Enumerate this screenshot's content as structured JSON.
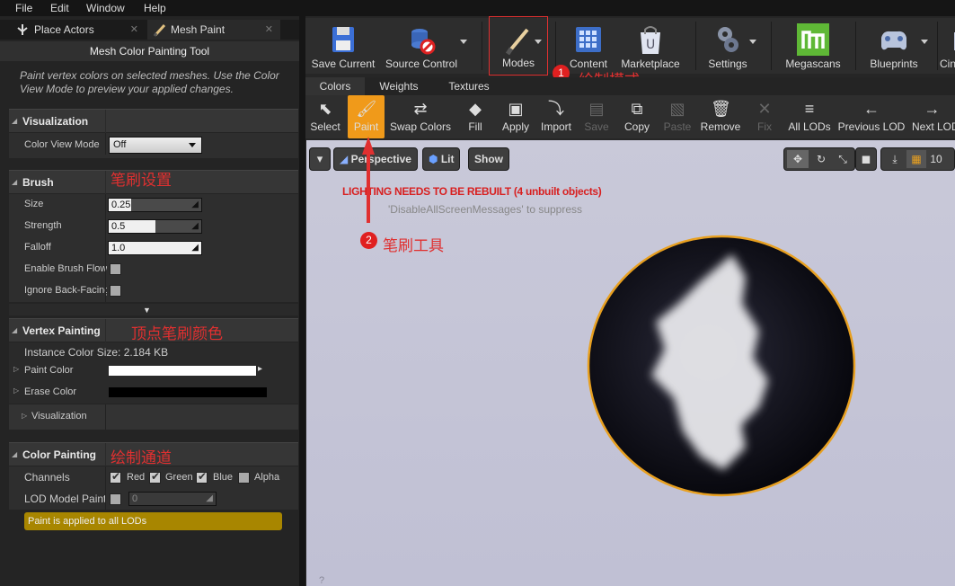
{
  "menu": {
    "file": "File",
    "edit": "Edit",
    "window": "Window",
    "help": "Help"
  },
  "left_tabs": {
    "place_actors": "Place Actors",
    "mesh_paint": "Mesh Paint",
    "close": "✕"
  },
  "tool_title": "Mesh Color Painting Tool",
  "description": "Paint vertex colors on selected meshes.  Use the Color View Mode to preview your applied changes.",
  "visualization": {
    "header": "Visualization",
    "color_view_mode_label": "Color View Mode",
    "color_view_mode_value": "Off"
  },
  "brush": {
    "header": "Brush",
    "size_label": "Size",
    "size_value": "0.25",
    "strength_label": "Strength",
    "strength_value": "0.5",
    "falloff_label": "Falloff",
    "falloff_value": "1.0",
    "enable_flow_label": "Enable Brush Flow",
    "ignore_backface_label": "Ignore Back-Facing"
  },
  "vertex_painting": {
    "header": "Vertex Painting",
    "instance_size": "Instance Color Size: 2.184 KB",
    "paint_color_label": "Paint Color",
    "erase_color_label": "Erase Color",
    "visualization_label": "Visualization",
    "paint_color": "#ffffff",
    "erase_color": "#000000"
  },
  "color_painting": {
    "header": "Color Painting",
    "channels_label": "Channels",
    "red": "Red",
    "green": "Green",
    "blue": "Blue",
    "alpha": "Alpha",
    "lod_label": "LOD Model Painting",
    "lod_value": "0",
    "notice": "Paint is applied to all LODs"
  },
  "annotations": {
    "brush_settings": "笔刷设置",
    "vertex_color": "顶点笔刷颜色",
    "paint_channel": "绘制通道",
    "paint_mode": "绘制模式",
    "brush_tool": "笔刷工具",
    "num1": "1",
    "num2": "2"
  },
  "toolbar": {
    "save_current": "Save Current",
    "source_control": "Source Control",
    "modes": "Modes",
    "content": "Content",
    "marketplace": "Marketplace",
    "settings": "Settings",
    "megascans": "Megascans",
    "blueprints": "Blueprints",
    "cinematics": "Cin"
  },
  "subtabs": {
    "colors": "Colors",
    "weights": "Weights",
    "textures": "Textures"
  },
  "paint_tools": {
    "select": "Select",
    "paint": "Paint",
    "swap": "Swap Colors",
    "fill": "Fill",
    "apply": "Apply",
    "import": "Import",
    "save": "Save",
    "copy": "Copy",
    "paste": "Paste",
    "remove": "Remove",
    "fix": "Fix",
    "all_lods": "All LODs",
    "prev_lod": "Previous LOD",
    "next_lod": "Next LOD"
  },
  "viewport": {
    "perspective": "Perspective",
    "lit": "Lit",
    "show": "Show",
    "warning": "LIGHTING NEEDS TO BE REBUILT (4 unbuilt objects)",
    "suppress": "'DisableAllScreenMessages' to suppress",
    "grid_size": "10"
  },
  "colors": {
    "accent": "#f0a020",
    "annotation": "#e03030",
    "notice_bg": "#a88600"
  }
}
